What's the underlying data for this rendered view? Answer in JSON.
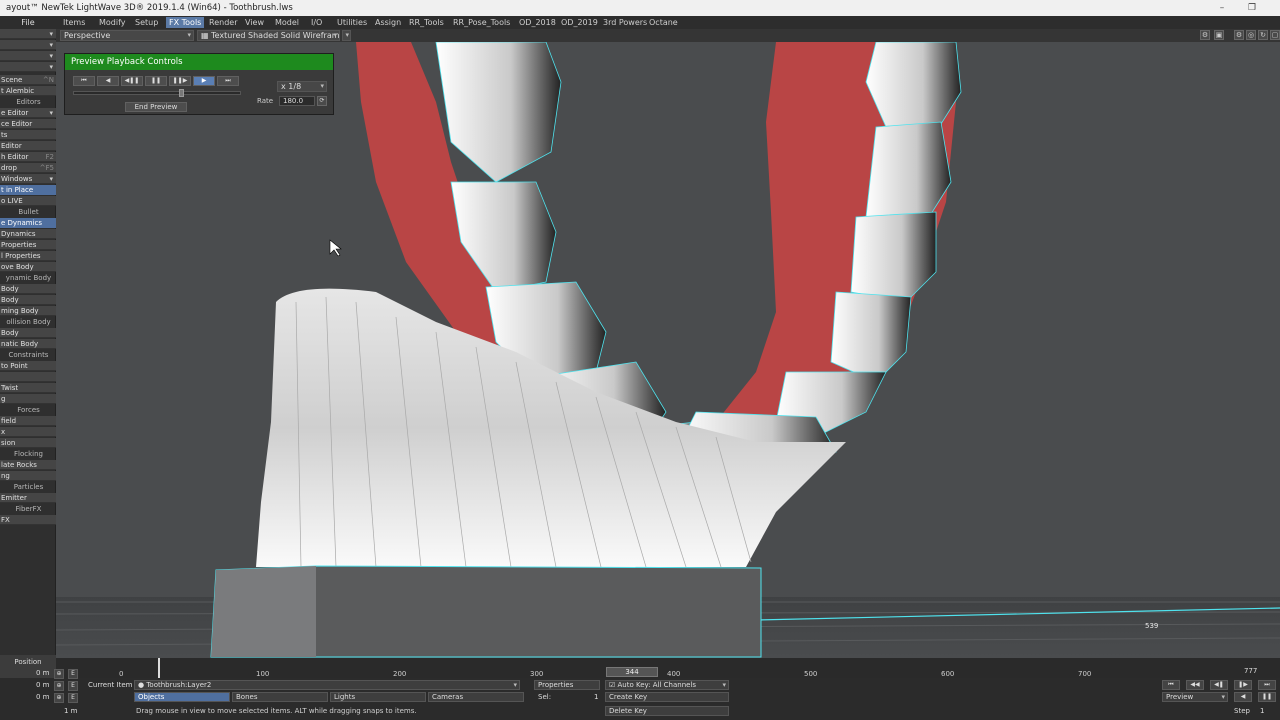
{
  "window": {
    "title": "ayout™ NewTek LightWave 3D® 2019.1.4 (Win64) - Toothbrush.lws",
    "minimize": "–",
    "restore": "❐"
  },
  "menu": {
    "file": "File",
    "tabs": [
      "Items",
      "Modify",
      "Setup",
      "FX Tools",
      "Render",
      "View",
      "Model",
      "I/O",
      "Utilities",
      "Assign",
      "RR_Tools",
      "RR_Pose_Tools",
      "OD_2018",
      "OD_2019",
      "3rd Powers",
      "Octane"
    ],
    "active_tab": "FX Tools"
  },
  "viewport": {
    "view_mode": "Perspective",
    "render_mode": "Textured Shaded Solid Wireframe",
    "overlay_number": "539"
  },
  "sidebar": {
    "items": [
      {
        "label": "Scene",
        "shortcut": "^N",
        "kind": "btn"
      },
      {
        "label": "t Alembic",
        "kind": "btn"
      },
      {
        "label": "Editors",
        "kind": "hdr"
      },
      {
        "label": "e Editor",
        "kind": "btn",
        "dropdown": true
      },
      {
        "label": "ce Editor",
        "kind": "btn"
      },
      {
        "label": "ts",
        "kind": "btn"
      },
      {
        "label": "Editor",
        "kind": "btn"
      },
      {
        "label": "h Editor",
        "shortcut": "F2",
        "kind": "btn"
      },
      {
        "label": "drop",
        "shortcut": "^F5",
        "kind": "btn"
      },
      {
        "label": "Windows",
        "kind": "btn",
        "dropdown": true
      },
      {
        "label": "t in Place",
        "kind": "hl"
      },
      {
        "label": "o LIVE",
        "kind": "btn"
      },
      {
        "label": "Bullet",
        "kind": "hdr"
      },
      {
        "label": "e Dynamics",
        "kind": "hl"
      },
      {
        "label": "Dynamics",
        "kind": "btn"
      },
      {
        "label": "Properties",
        "kind": "btn"
      },
      {
        "label": "l Properties",
        "kind": "btn"
      },
      {
        "label": "ove Body",
        "kind": "btn"
      },
      {
        "label": "ynamic Body",
        "kind": "hdr"
      },
      {
        "label": "Body",
        "kind": "btn"
      },
      {
        "label": "Body",
        "kind": "btn"
      },
      {
        "label": "ming Body",
        "kind": "btn"
      },
      {
        "label": "ollision Body",
        "kind": "hdr"
      },
      {
        "label": "Body",
        "kind": "btn"
      },
      {
        "label": "natic Body",
        "kind": "btn"
      },
      {
        "label": "Constraints",
        "kind": "hdr"
      },
      {
        "label": "to Point",
        "kind": "btn"
      },
      {
        "label": "",
        "kind": "btn"
      },
      {
        "label": "Twist",
        "kind": "btn"
      },
      {
        "label": "g",
        "kind": "btn"
      },
      {
        "label": "Forces",
        "kind": "hdr"
      },
      {
        "label": "field",
        "kind": "btn"
      },
      {
        "label": "x",
        "kind": "btn"
      },
      {
        "label": "sion",
        "kind": "btn"
      },
      {
        "label": "Flocking",
        "kind": "hdr"
      },
      {
        "label": "late Rocks",
        "kind": "btn"
      },
      {
        "label": "ng",
        "kind": "btn"
      },
      {
        "label": "Particles",
        "kind": "hdr"
      },
      {
        "label": "Emitter",
        "kind": "btn"
      },
      {
        "label": "FiberFX",
        "kind": "hdr"
      },
      {
        "label": "FX",
        "kind": "btn"
      }
    ]
  },
  "preview_panel": {
    "title": "Preview Playback Controls",
    "buttons": [
      "⏮",
      "◀",
      "◀❚❚",
      "❚❚",
      "❚❚▶",
      "▶",
      "⏭"
    ],
    "active_button": 5,
    "speed": "x 1/8",
    "rate_label": "Rate",
    "rate_value": "180.0",
    "end_button": "End Preview",
    "slider_level": 0.63
  },
  "timeline": {
    "ticks": [
      "0",
      "100",
      "200",
      "300",
      "400",
      "500",
      "600",
      "700"
    ],
    "current_frame": "344",
    "end_frame": "777",
    "position_label": "Position"
  },
  "bottom": {
    "rows": [
      {
        "value": "0 m"
      },
      {
        "value": "0 m"
      },
      {
        "value": "0 m"
      }
    ],
    "grid_value": "1 m",
    "current_item_label": "Current Item",
    "current_item": "Toothbrush:Layer2",
    "item_types": [
      "Objects",
      "Bones",
      "Lights",
      "Cameras"
    ],
    "properties": "Properties",
    "sel_label": "Sel:",
    "sel_value": "1",
    "auto_key": "Auto Key: All Channels",
    "create_key": "Create Key",
    "delete_key": "Delete Key",
    "status": "Drag mouse in view to move selected items. ALT while dragging snaps to items.",
    "preview_select": "Preview",
    "step_label": "Step",
    "step_value": "1"
  },
  "colors": {
    "accent": "#5b7aa6",
    "panel_title": "#1e8a1e",
    "gum": "#b94545",
    "wire": "#4fe3ee"
  }
}
